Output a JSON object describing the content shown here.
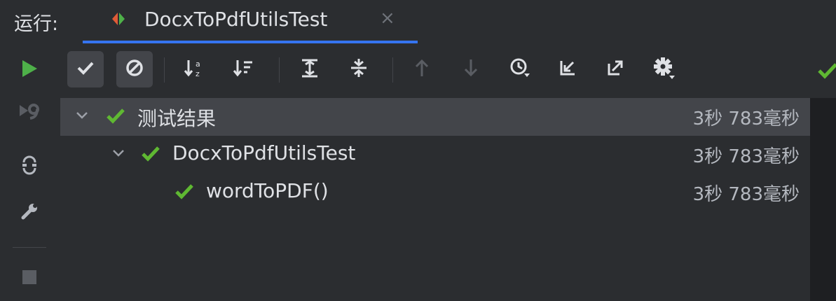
{
  "window": {
    "run_label": "运行:",
    "tab_title": "DocxToPdfUtilsTest",
    "tab_close": "×"
  },
  "colors": {
    "accent": "#3574f0",
    "success": "#5fb832",
    "run_green": "#4eb049",
    "background": "#2b2d30",
    "selected_row": "#43454a"
  },
  "leftbar": [
    {
      "name": "run-icon"
    },
    {
      "name": "rerun-failed-icon"
    },
    {
      "name": "toggle-auto-test-icon"
    },
    {
      "name": "wrench-icon"
    },
    {
      "name": "stop-icon"
    }
  ],
  "toolbar": [
    {
      "name": "show-passed-button",
      "icon": "check-icon",
      "active": true
    },
    {
      "name": "show-ignored-button",
      "icon": "ignore-icon",
      "active": true
    },
    {
      "name": "sort-alphabetically-button",
      "icon": "sort-alpha-icon"
    },
    {
      "name": "sort-by-duration-button",
      "icon": "sort-duration-icon"
    },
    {
      "name": "expand-all-button",
      "icon": "expand-all-icon"
    },
    {
      "name": "collapse-all-button",
      "icon": "collapse-all-icon"
    },
    {
      "name": "previous-failed-button",
      "icon": "arrow-up-icon"
    },
    {
      "name": "next-failed-button",
      "icon": "arrow-down-icon"
    },
    {
      "name": "test-history-button",
      "icon": "history-icon"
    },
    {
      "name": "import-tests-button",
      "icon": "import-icon"
    },
    {
      "name": "export-tests-button",
      "icon": "export-icon"
    },
    {
      "name": "settings-button",
      "icon": "gear-icon"
    }
  ],
  "tree": [
    {
      "label": "测试结果",
      "time": "3秒 783毫秒",
      "level": 0,
      "expanded": true,
      "status": "passed",
      "selected": true
    },
    {
      "label": "DocxToPdfUtilsTest",
      "time": "3秒 783毫秒",
      "level": 1,
      "expanded": true,
      "status": "passed"
    },
    {
      "label": "wordToPDF()",
      "time": "3秒 783毫秒",
      "level": 2,
      "status": "passed"
    }
  ]
}
